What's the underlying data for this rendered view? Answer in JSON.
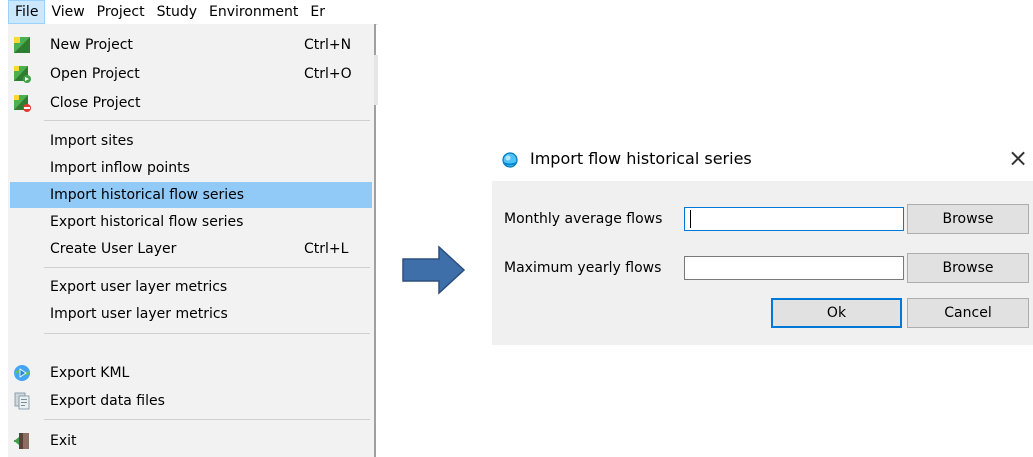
{
  "menubar": {
    "items": [
      {
        "label": "File"
      },
      {
        "label": "View"
      },
      {
        "label": "Project"
      },
      {
        "label": "Study"
      },
      {
        "label": "Environment"
      },
      {
        "label": "Er"
      }
    ]
  },
  "file_menu": {
    "items": [
      {
        "label": "New Project",
        "shortcut": "Ctrl+N",
        "icon": "new-project-icon"
      },
      {
        "label": "Open Project",
        "shortcut": "Ctrl+O",
        "icon": "open-project-icon"
      },
      {
        "label": "Close Project",
        "shortcut": "",
        "icon": "close-project-icon"
      },
      {
        "label": "Import sites",
        "shortcut": ""
      },
      {
        "label": "Import inflow points",
        "shortcut": ""
      },
      {
        "label": "Import historical flow series",
        "shortcut": "",
        "highlighted": true
      },
      {
        "label": "Export historical flow series",
        "shortcut": ""
      },
      {
        "label": "Create User Layer",
        "shortcut": "Ctrl+L"
      },
      {
        "label": "Export user layer metrics",
        "shortcut": ""
      },
      {
        "label": "Import user layer metrics",
        "shortcut": ""
      },
      {
        "label": "Export KML",
        "shortcut": "",
        "icon": "globe-arrow-icon"
      },
      {
        "label": "Export data files",
        "shortcut": "",
        "icon": "data-files-icon"
      },
      {
        "label": "Exit",
        "shortcut": "",
        "icon": "exit-door-icon"
      }
    ]
  },
  "dialog": {
    "title": "Import flow historical series",
    "close_glyph": "×",
    "fields": [
      {
        "label": "Monthly average flows",
        "value": "",
        "button": "Browse"
      },
      {
        "label": "Maximum yearly flows",
        "value": "",
        "button": "Browse"
      }
    ],
    "ok_label": "Ok",
    "cancel_label": "Cancel"
  },
  "colors": {
    "highlight": "#91c9f7",
    "menu_background": "#f2f2f2",
    "arrow_fill": "#3f6fa9",
    "focus_border": "#0078d7"
  }
}
